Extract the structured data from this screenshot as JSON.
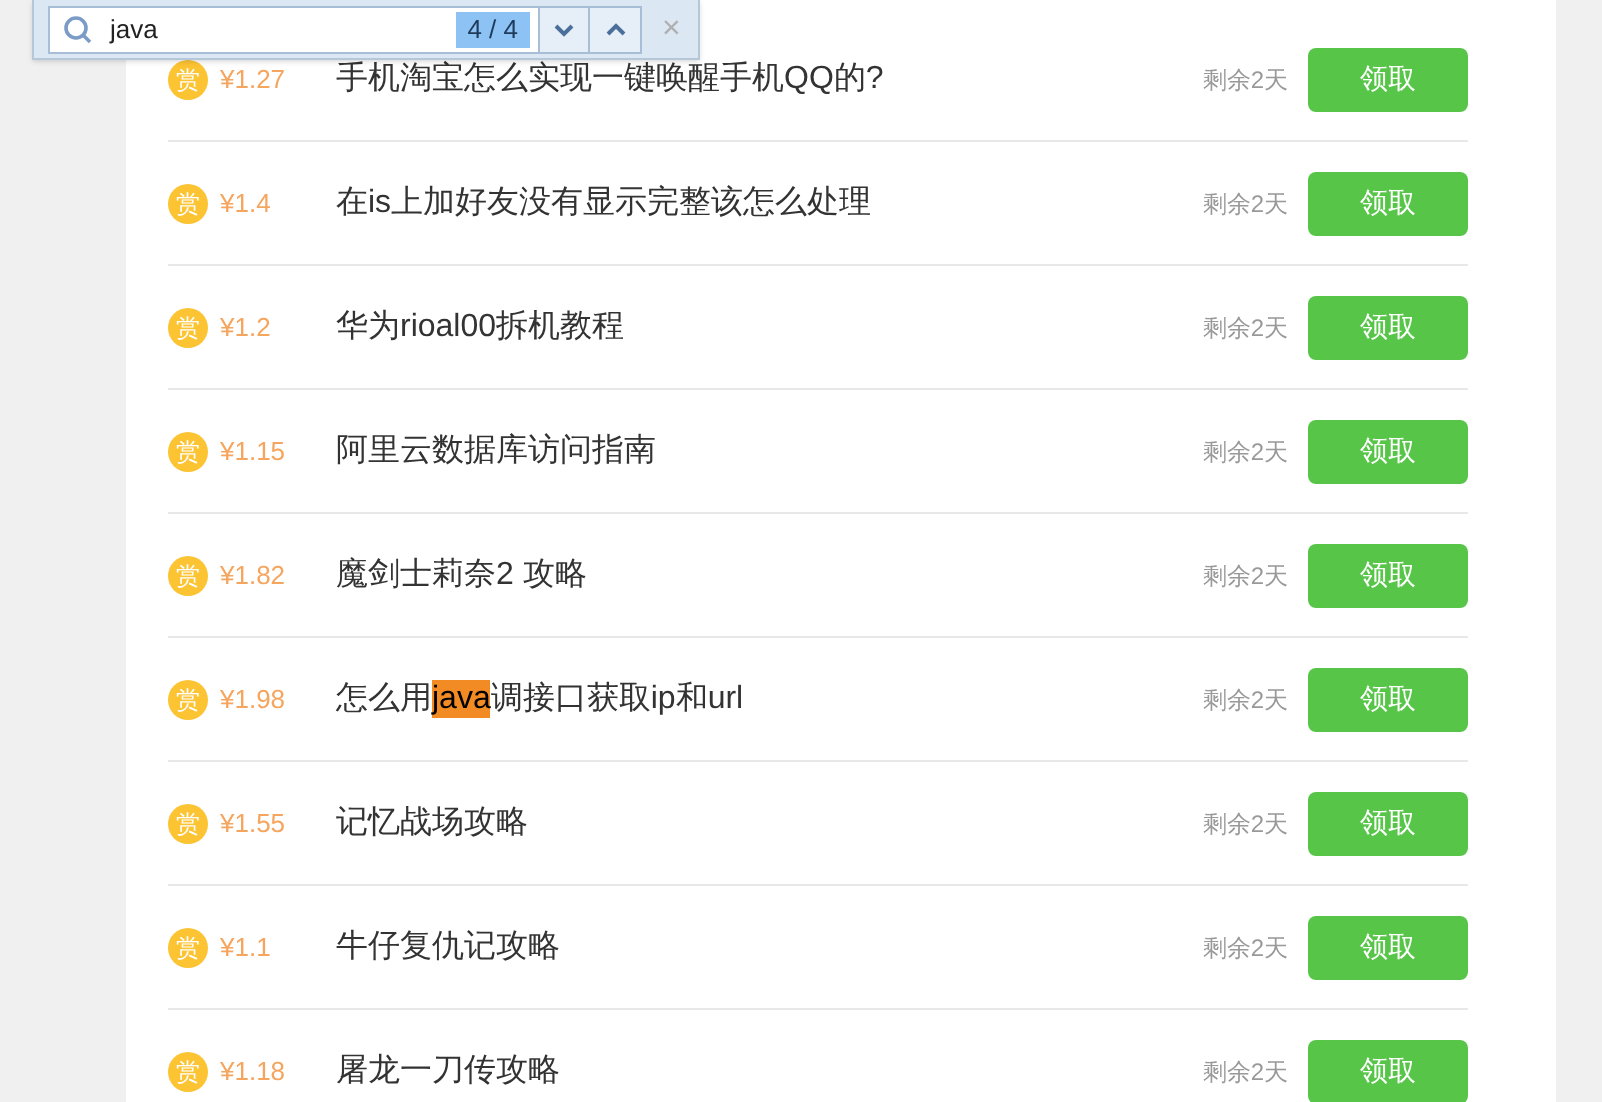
{
  "find_bar": {
    "query": "java",
    "count": "4 / 4",
    "close": "×"
  },
  "rows": [
    {
      "badge": "赏",
      "price": "¥1.27",
      "title": [
        {
          "text": "手机淘宝怎么实现一键唤醒手机QQ的?",
          "highlighted": false
        }
      ],
      "remaining": "剩余2天",
      "button": "领取"
    },
    {
      "badge": "赏",
      "price": "¥1.4",
      "title": [
        {
          "text": "在is上加好友没有显示完整该怎么处理",
          "highlighted": false
        }
      ],
      "remaining": "剩余2天",
      "button": "领取"
    },
    {
      "badge": "赏",
      "price": "¥1.2",
      "title": [
        {
          "text": "华为rioal00拆机教程",
          "highlighted": false
        }
      ],
      "remaining": "剩余2天",
      "button": "领取"
    },
    {
      "badge": "赏",
      "price": "¥1.15",
      "title": [
        {
          "text": "阿里云数据库访问指南",
          "highlighted": false
        }
      ],
      "remaining": "剩余2天",
      "button": "领取"
    },
    {
      "badge": "赏",
      "price": "¥1.82",
      "title": [
        {
          "text": "魔剑士莉奈2 攻略",
          "highlighted": false
        }
      ],
      "remaining": "剩余2天",
      "button": "领取"
    },
    {
      "badge": "赏",
      "price": "¥1.98",
      "title": [
        {
          "text": "怎么用",
          "highlighted": false
        },
        {
          "text": "java",
          "highlighted": true
        },
        {
          "text": "调接口获取ip和url",
          "highlighted": false
        }
      ],
      "remaining": "剩余2天",
      "button": "领取"
    },
    {
      "badge": "赏",
      "price": "¥1.55",
      "title": [
        {
          "text": "记忆战场攻略",
          "highlighted": false
        }
      ],
      "remaining": "剩余2天",
      "button": "领取"
    },
    {
      "badge": "赏",
      "price": "¥1.1",
      "title": [
        {
          "text": "牛仔复仇记攻略",
          "highlighted": false
        }
      ],
      "remaining": "剩余2天",
      "button": "领取"
    },
    {
      "badge": "赏",
      "price": "¥1.18",
      "title": [
        {
          "text": "屠龙一刀传攻略",
          "highlighted": false
        }
      ],
      "remaining": "剩余2天",
      "button": "领取"
    }
  ]
}
